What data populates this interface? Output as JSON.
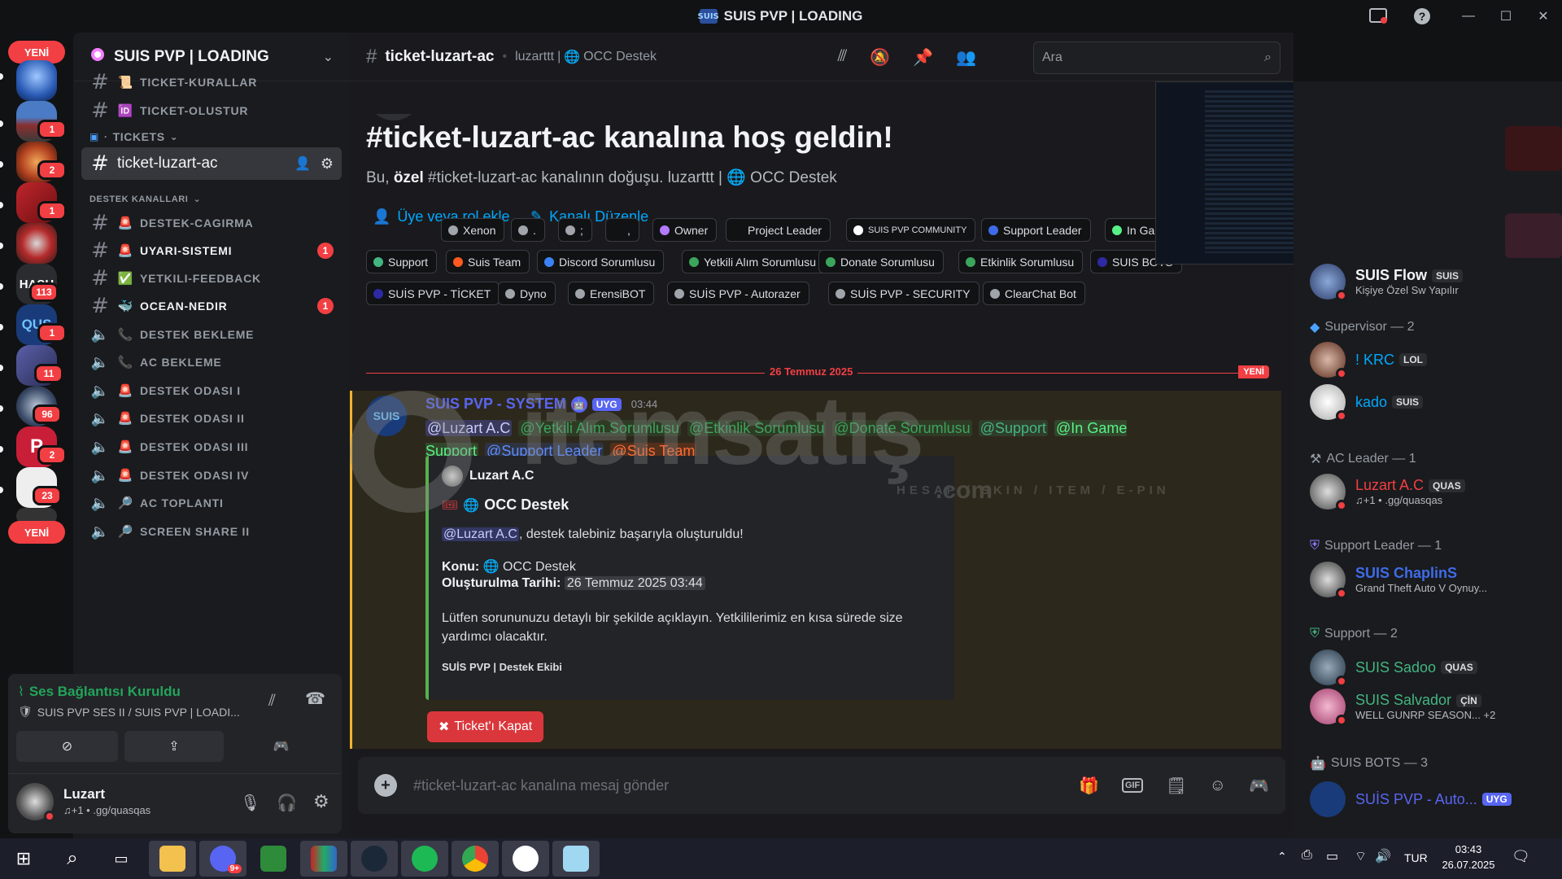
{
  "window": {
    "title": "SUIS PVP | LOADING",
    "server_glyph": "SUIS"
  },
  "rail": {
    "new_top": "YENİ",
    "new_bottom": "YENİ",
    "servers": [
      {
        "name": "server-1",
        "badge": ""
      },
      {
        "name": "server-2",
        "badge": "1"
      },
      {
        "name": "server-3",
        "badge": "2"
      },
      {
        "name": "server-4",
        "badge": "1"
      },
      {
        "name": "server-5",
        "badge": ""
      },
      {
        "name": "server-6",
        "badge": "113"
      },
      {
        "name": "server-7",
        "badge": "1"
      },
      {
        "name": "server-8",
        "badge": "11"
      },
      {
        "name": "server-9",
        "badge": "96"
      },
      {
        "name": "server-10",
        "badge": "2"
      },
      {
        "name": "server-11",
        "badge": "23"
      }
    ],
    "server6_label": "HASH",
    "server7_label": "QUS"
  },
  "sidebar": {
    "server_name": "SUIS PVP | LOADING",
    "channels_top": [
      {
        "label": "TICKET-KURALLAR",
        "emoji": "📜"
      },
      {
        "label": "TICKET-OLUSTUR",
        "emoji": "🆔"
      }
    ],
    "tickets_category": "TICKETS",
    "active_channel": "ticket-luzart-ac",
    "destek_category": "DESTEK KANALLARI",
    "channels": [
      {
        "label": "DESTEK-CAGIRMA",
        "emoji": "🚨",
        "unread": false,
        "count": ""
      },
      {
        "label": "UYARI-SISTEMI",
        "emoji": "🚨",
        "unread": true,
        "count": "1"
      },
      {
        "label": "YETKILI-FEEDBACK",
        "emoji": "✅",
        "unread": false,
        "count": ""
      },
      {
        "label": "OCEAN-NEDIR",
        "emoji": "🐳",
        "unread": true,
        "count": "1"
      },
      {
        "label": "DESTEK BEKLEME",
        "emoji": "📞",
        "unread": false,
        "count": ""
      },
      {
        "label": "AC BEKLEME",
        "emoji": "📞",
        "unread": false,
        "count": ""
      },
      {
        "label": "DESTEK ODASI I",
        "emoji": "🚨",
        "unread": false,
        "count": ""
      },
      {
        "label": "DESTEK ODASI II",
        "emoji": "🚨",
        "unread": false,
        "count": ""
      },
      {
        "label": "DESTEK ODASI III",
        "emoji": "🚨",
        "unread": false,
        "count": ""
      },
      {
        "label": "DESTEK ODASI IV",
        "emoji": "🚨",
        "unread": false,
        "count": ""
      },
      {
        "label": "AC TOPLANTI",
        "emoji": "🔎",
        "unread": false,
        "count": ""
      },
      {
        "label": "SCREEN SHARE II",
        "emoji": "🔎",
        "unread": false,
        "count": ""
      }
    ],
    "voice": {
      "status": "Ses Bağlantısı Kuruldu",
      "channel": "SUIS PVP SES II / SUIS PVP | LOADI..."
    },
    "user": {
      "name": "Luzart",
      "status": "♫+1 • .gg/quasqas"
    }
  },
  "header": {
    "channel_name": "ticket-luzart-ac",
    "topic_user": "luzarttt",
    "topic_channel": "OCC Destek",
    "search_placeholder": "Ara"
  },
  "welcome": {
    "title": "#ticket-luzart-ac kanalına hoş geldin!",
    "sub_prefix": "Bu, ",
    "sub_bold": "özel",
    "sub_rest": " #ticket-luzart-ac kanalının doğuşu. luzarttt | ",
    "sub_channel": "OCC Destek",
    "add_member": "Üye veya rol ekle",
    "edit_channel": "Kanalı Düzenle"
  },
  "roles": [
    {
      "label": "Xenon",
      "color": "#a0a4ab"
    },
    {
      "label": ".",
      "color": "#a0a4ab"
    },
    {
      "label": ";",
      "color": "#a0a4ab"
    },
    {
      "label": ",",
      "color": "#111214"
    },
    {
      "label": "Owner",
      "color": "#b379ff"
    },
    {
      "label": "Project Leader",
      "color": "#111214"
    },
    {
      "label": "SUIS PVP COMMUNITY",
      "color": "#ffffff"
    },
    {
      "label": "Support Leader",
      "color": "#3e6ce8"
    },
    {
      "label": "In Game Support",
      "color": "#57f287"
    },
    {
      "label": "Support",
      "color": "#43b581"
    },
    {
      "label": "Suis Team",
      "color": "#ff5a1f"
    },
    {
      "label": "Discord Sorumlusu",
      "color": "#3b82f6"
    },
    {
      "label": "Yetkili Alım Sorumlusu",
      "color": "#3ba55c"
    },
    {
      "label": "Donate Sorumlusu",
      "color": "#3ba55c"
    },
    {
      "label": "Etkinlik Sorumlusu",
      "color": "#3ba55c"
    },
    {
      "label": "SUIS BOTS",
      "color": "#2d2aa3"
    },
    {
      "label": "SUİS PVP - TİCKET",
      "color": "#2d2aa3"
    },
    {
      "label": "Dyno",
      "color": "#a0a4ab"
    },
    {
      "label": "ErensiBOT",
      "color": "#a0a4ab"
    },
    {
      "label": "SUİS PVP - Autorazer",
      "color": "#a0a4ab"
    },
    {
      "label": "SUİS PVP - SECURITY",
      "color": "#a0a4ab"
    },
    {
      "label": "ClearChat Bot",
      "color": "#a0a4ab"
    }
  ],
  "divider": {
    "date": "26 Temmuz 2025",
    "new": "YENİ"
  },
  "message": {
    "author": "SUIS PVP - SYSTEM",
    "app_tag": "UYG",
    "time": "03:44",
    "mentions": [
      {
        "text": "@Luzart A.C",
        "color": "#c9cdfb",
        "bg": "rgba(88,101,242,0.3)"
      },
      {
        "text": "@Yetkili Alım Sorumlusu",
        "color": "#3ba55c",
        "bg": "rgba(59,165,92,0.15)"
      },
      {
        "text": "@Etkinlik Sorumlusu",
        "color": "#3ba55c",
        "bg": "rgba(59,165,92,0.15)"
      },
      {
        "text": "@Donate Sorumlusu",
        "color": "#3ba55c",
        "bg": "rgba(59,165,92,0.15)"
      },
      {
        "text": "@Support",
        "color": "#43b581",
        "bg": "rgba(67,181,129,0.15)"
      },
      {
        "text": "@In Game Support",
        "color": "#57f287",
        "bg": "rgba(87,242,135,0.15)"
      },
      {
        "text": "@Support Leader",
        "color": "#5b8cff",
        "bg": "rgba(62,108,232,0.18)"
      },
      {
        "text": "@Suis Team",
        "color": "#ff6b35",
        "bg": "rgba(255,90,31,0.18)"
      }
    ],
    "embed": {
      "author": "Luzart A.C",
      "title": "OCC Destek",
      "mention": "@Luzart A.C",
      "line1": ", destek talebiniz başarıyla oluşturuldu!",
      "konu_label": "Konu:",
      "konu_value": "OCC Destek",
      "tarih_label": "Oluşturulma Tarihi:",
      "tarih_value": "26 Temmuz 2025 03:44",
      "body": "Lütfen sorununuzu detaylı bir şekilde açıklayın. Yetkililerimiz en kısa sürede size yardımcı olacaktır.",
      "footer": "SUİS PVP | Destek Ekibi"
    },
    "close_button": "Ticket'ı Kapat"
  },
  "composer": {
    "placeholder": "#ticket-luzart-ac kanalına mesaj gönder"
  },
  "watermark": {
    "brand": "itemsatış",
    "domain": ".com",
    "tagline": "HESAP / SKIN / ITEM / E-PIN"
  },
  "members": {
    "top": {
      "name": "SUIS Flow",
      "tag": "SUIS",
      "activity": "Kişiye Özel Sw Yapılır"
    },
    "groups": [
      {
        "title": "Supervisor — 2",
        "members": [
          {
            "name": "! KRC",
            "tag": "LOL",
            "activity": "",
            "color": "#00a8fc"
          },
          {
            "name": "kado",
            "tag": "SUIS",
            "activity": "",
            "color": "#00a8fc"
          }
        ]
      },
      {
        "title": "AC Leader — 1",
        "members": [
          {
            "name": "Luzart A.C",
            "tag": "QUAS",
            "activity": "♫+1 • .gg/quasqas",
            "color": "#f23f43"
          }
        ]
      },
      {
        "title": "Support Leader — 1",
        "members": [
          {
            "name": "SUIS ChaplinS",
            "tag": "",
            "activity": "Grand Theft Auto V Oynuy...",
            "color": "#3e6ce8"
          }
        ]
      },
      {
        "title": "Support — 2",
        "members": [
          {
            "name": "SUIS Sadoo",
            "tag": "QUAS",
            "activity": "",
            "color": "#43b581"
          },
          {
            "name": "SUIS Salvador",
            "tag": "ÇİN",
            "activity": "WELL GUNRP SEASON... +2",
            "color": "#43b581"
          }
        ]
      },
      {
        "title": "SUIS BOTS — 3",
        "members": [
          {
            "name": "SUİS PVP - Auto...",
            "tag": "UYG",
            "activity": "",
            "color": "#5865f2"
          }
        ]
      }
    ]
  },
  "taskbar": {
    "lang": "TUR",
    "time": "03:43",
    "date": "26.07.2025",
    "discord_badge": "9+"
  }
}
